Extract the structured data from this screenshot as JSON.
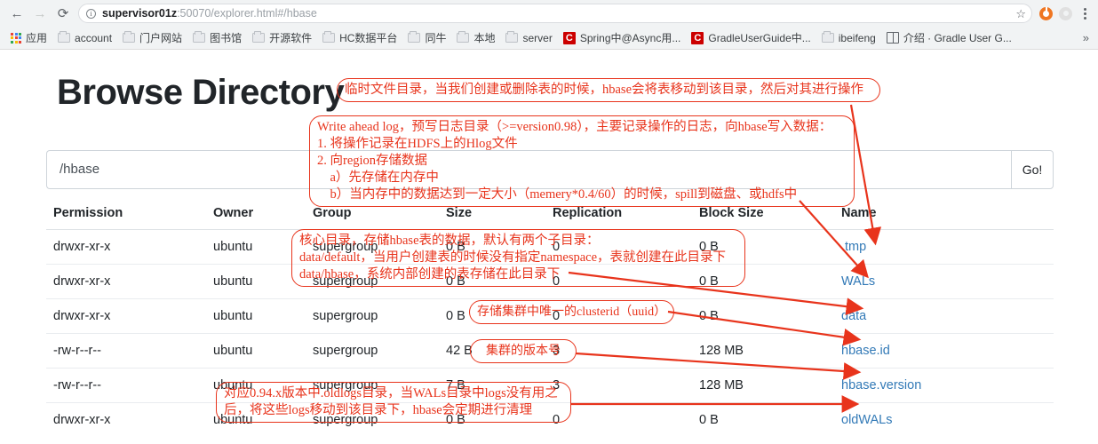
{
  "browser": {
    "nav": {
      "back": "←",
      "forward": "→",
      "reload": "⟳"
    },
    "omnibox": {
      "info_icon": "i",
      "url_host": "supervisor01z",
      "url_rest": ":50070/explorer.html#/hbase",
      "star_icon": "☆"
    },
    "bookmarks": [
      {
        "icon": "apps-grid-icon",
        "label": "应用"
      },
      {
        "icon": "folder-icon",
        "label": "account"
      },
      {
        "icon": "folder-icon",
        "label": "门户网站"
      },
      {
        "icon": "folder-icon",
        "label": "图书馆"
      },
      {
        "icon": "folder-icon",
        "label": "开源软件"
      },
      {
        "icon": "folder-icon",
        "label": "HC数据平台"
      },
      {
        "icon": "folder-icon",
        "label": "同牛"
      },
      {
        "icon": "folder-icon",
        "label": "本地"
      },
      {
        "icon": "folder-icon",
        "label": "server"
      },
      {
        "icon": "csdn-icon",
        "label": "Spring中@Async用..."
      },
      {
        "icon": "csdn-icon",
        "label": "GradleUserGuide中..."
      },
      {
        "icon": "folder-icon",
        "label": "ibeifeng"
      },
      {
        "icon": "book-icon",
        "label": "介绍 · Gradle User G..."
      }
    ],
    "overflow_icon": "»"
  },
  "page": {
    "title": "Browse Directory",
    "path_value": "/hbase",
    "go_label": "Go!",
    "columns": [
      "Permission",
      "Owner",
      "Group",
      "Size",
      "Replication",
      "Block Size",
      "Name"
    ],
    "rows": [
      {
        "permission": "drwxr-xr-x",
        "owner": "ubuntu",
        "group": "supergroup",
        "size": "0 B",
        "replication": "0",
        "block": "0 B",
        "name": ".tmp"
      },
      {
        "permission": "drwxr-xr-x",
        "owner": "ubuntu",
        "group": "supergroup",
        "size": "0 B",
        "replication": "0",
        "block": "0 B",
        "name": "WALs"
      },
      {
        "permission": "drwxr-xr-x",
        "owner": "ubuntu",
        "group": "supergroup",
        "size": "0 B",
        "replication": "0",
        "block": "0 B",
        "name": "data"
      },
      {
        "permission": "-rw-r--r--",
        "owner": "ubuntu",
        "group": "supergroup",
        "size": "42 B",
        "replication": "3",
        "block": "128 MB",
        "name": "hbase.id"
      },
      {
        "permission": "-rw-r--r--",
        "owner": "ubuntu",
        "group": "supergroup",
        "size": "7 B",
        "replication": "3",
        "block": "128 MB",
        "name": "hbase.version"
      },
      {
        "permission": "drwxr-xr-x",
        "owner": "ubuntu",
        "group": "supergroup",
        "size": "0 B",
        "replication": "0",
        "block": "0 B",
        "name": "oldWALs"
      }
    ]
  },
  "annotations": {
    "color": "#e8341c",
    "tmp": "临时文件目录，当我们创建或删除表的时候，hbase会将表移动到该目录，然后对其进行操作",
    "wals": "Write ahead log，预写日志目录（>=version0.98），主要记录操作的日志，向hbase写入数据：\n1. 将操作记录在HDFS上的Hlog文件\n2. 向region存储数据\n    a）先存储在内存中\n    b）当内存中的数据达到一定大小（memery*0.4/60）的时候，spill到磁盘、或hdfs中",
    "data": "核心目录，存储hbase表的数据，默认有两个子目录：\ndata/default，当用户创建表的时候没有指定namespace，表就创建在此目录下\ndata/hbase，系统内部创建的表存储在此目录下",
    "hbase_id": "存储集群中唯一的clusterid（uuid）",
    "hbase_version": "集群的版本号",
    "oldwals": "对应0.94.x版本中.oldlogs目录，当WALs目录中logs没有用之\n后，将这些logs移动到该目录下，hbase会定期进行清理"
  }
}
